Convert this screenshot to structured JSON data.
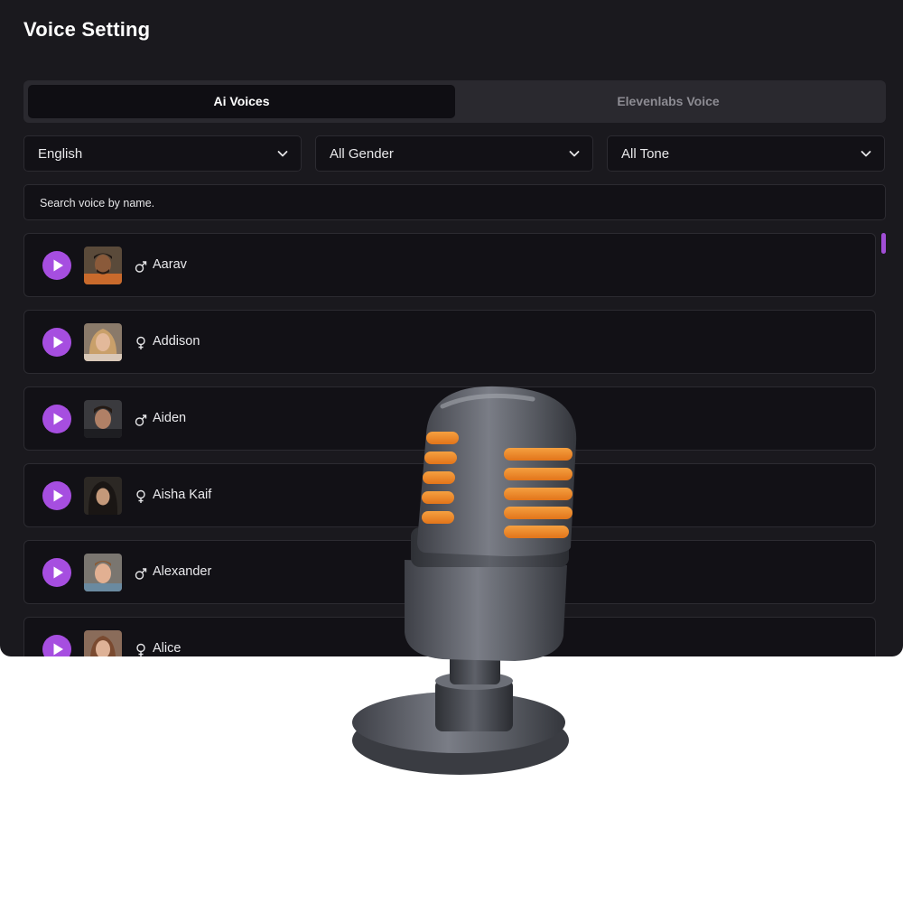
{
  "page": {
    "title": "Voice Setting"
  },
  "tabs": [
    {
      "label": "Ai Voices",
      "active": true
    },
    {
      "label": "Elevenlabs Voice",
      "active": false
    }
  ],
  "filters": {
    "language": "English",
    "gender": "All Gender",
    "tone": "All Tone"
  },
  "search": {
    "placeholder": "Search voice by name."
  },
  "voices": [
    {
      "name": "Aarav",
      "gender": "male"
    },
    {
      "name": "Addison",
      "gender": "female"
    },
    {
      "name": "Aiden",
      "gender": "male"
    },
    {
      "name": "Aisha Kaif",
      "gender": "female"
    },
    {
      "name": "Alexander",
      "gender": "male"
    },
    {
      "name": "Alice",
      "gender": "female"
    }
  ],
  "colors": {
    "accent": "#a64ee0",
    "panel": "#1a191e",
    "mic_orange": "#f08a1c"
  },
  "icons": {
    "play": "play-icon",
    "male": "male-symbol-icon",
    "female": "female-symbol-icon",
    "dropdown": "chevron-down-icon"
  }
}
